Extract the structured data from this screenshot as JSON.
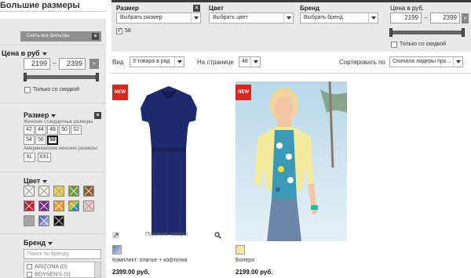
{
  "sidebar": {
    "title": "Большие размеры",
    "clear_filters": "Снять все фильтры",
    "price": {
      "title": "Цена в руб",
      "min": "2199",
      "max": "2399",
      "dash": "–",
      "discount_label": "Только со скидкой"
    },
    "size": {
      "title": "Размер",
      "women_standard_note": "Женские стандартные размеры",
      "women_standard": [
        "42",
        "44",
        "48",
        "50",
        "52",
        "54",
        "56",
        "58"
      ],
      "selected": "58",
      "american_note": "Америнканские женские размеры",
      "american": [
        "XL",
        "XXL"
      ]
    },
    "color": {
      "title": "Цвет",
      "swatches": [
        {
          "name": "white",
          "hex": "#f4f4f4"
        },
        {
          "name": "cream",
          "hex": "#f7f2e4"
        },
        {
          "name": "yellow",
          "hex": "#f4d24a"
        },
        {
          "name": "green",
          "hex": "#6f9a3a"
        },
        {
          "name": "brown",
          "hex": "#8a5a2a"
        },
        {
          "name": "red",
          "hex": "#c41c2a"
        },
        {
          "name": "purple",
          "hex": "#7a2a86"
        },
        {
          "name": "orange",
          "hex": "#ec9a2e"
        },
        {
          "name": "multicolor",
          "hex": "#4ab0c8"
        },
        {
          "name": "pink",
          "hex": "#f6c8cc"
        },
        {
          "name": "grey",
          "hex": "#a8a8a8"
        },
        {
          "name": "blue",
          "hex": "#3a4e9a"
        },
        {
          "name": "black",
          "hex": "#111111"
        }
      ]
    },
    "brand": {
      "title": "Бренд",
      "search_placeholder": "Поиск по бренду",
      "items": [
        "ARIZONA (0)",
        "BOYSEN'S (0)"
      ]
    }
  },
  "topbar": {
    "size": {
      "title": "Размер",
      "select": "Выбрать размер",
      "checked_value": "58"
    },
    "color": {
      "title": "Цвет",
      "select": "Выбрать цвет"
    },
    "brand": {
      "title": "Бренд",
      "select": "Выбрать бренд"
    },
    "price": {
      "title": "Цена в руб.",
      "min": "2199",
      "max": "2399",
      "dash": "–",
      "discount_label": "Только со скидкой"
    }
  },
  "toolbar": {
    "view_label": "Вид",
    "view_value": "3 товара в ряд",
    "per_page_label": "На странице",
    "per_page_value": "48",
    "sort_label": "Сортировать по",
    "sort_value": "Сначала лидеры про..."
  },
  "products": [
    {
      "badge": "NEW",
      "name": "Комплект: платье + кофточка",
      "price": "2399.00 руб.",
      "swatch_hex": "#5d7fae",
      "similar": "Похожие товары"
    },
    {
      "badge": "NEW",
      "name": "Болеро",
      "price": "2199.00 руб.",
      "swatch_hex": "#f2dc7a"
    }
  ],
  "colors": {
    "sidebar_bg": "#e9e9e9",
    "badge_red": "#d9261c",
    "dark_strip": "#3a3a3a"
  }
}
